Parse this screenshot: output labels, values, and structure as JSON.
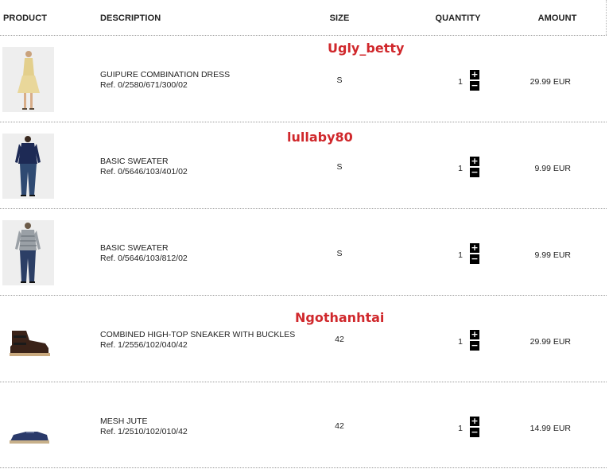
{
  "table": {
    "headers": {
      "product": "PRODUCT",
      "description": "DESCRIPTION",
      "size": "SIZE",
      "quantity": "QUANTITY",
      "amount": "AMOUNT"
    }
  },
  "stepper": {
    "plus": "+",
    "minus": "−"
  },
  "watermarks": [
    "Ugly_betty",
    "lullaby80",
    "Ngothanhtai"
  ],
  "items": [
    {
      "name": "GUIPURE COMBINATION DRESS",
      "ref": "Ref. 0/2580/671/300/02",
      "size": "S",
      "quantity": "1",
      "amount": "29.99 EUR",
      "image": "dress-image"
    },
    {
      "name": "BASIC SWEATER",
      "ref": "Ref. 0/5646/103/401/02",
      "size": "S",
      "quantity": "1",
      "amount": "9.99 EUR",
      "image": "navy-sweater-image"
    },
    {
      "name": "BASIC SWEATER",
      "ref": "Ref. 0/5646/103/812/02",
      "size": "S",
      "quantity": "1",
      "amount": "9.99 EUR",
      "image": "grey-sweater-image"
    },
    {
      "name": "COMBINED HIGH-TOP SNEAKER WITH BUCKLES",
      "ref": "Ref. 1/2556/102/040/42",
      "size": "42",
      "quantity": "1",
      "amount": "29.99 EUR",
      "image": "high-top-sneaker-image"
    },
    {
      "name": "MESH JUTE",
      "ref": "Ref. 1/2510/102/010/42",
      "size": "42",
      "quantity": "1",
      "amount": "14.99 EUR",
      "image": "jute-shoe-image"
    }
  ],
  "colors": {
    "watermark": "#d0282c",
    "stepper": "#000000",
    "divider": "#9a9a9a"
  }
}
